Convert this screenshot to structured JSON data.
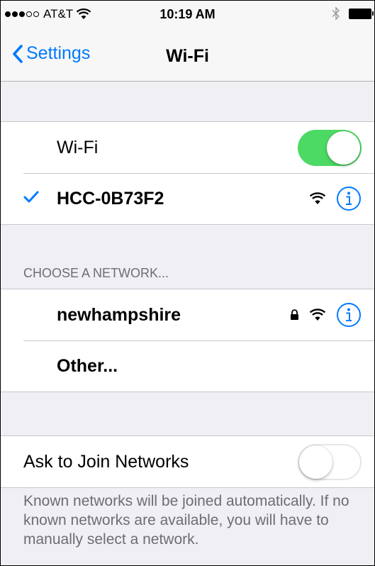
{
  "status_bar": {
    "carrier": "AT&T",
    "time": "10:19 AM",
    "signal_bars_filled": 3,
    "signal_bars_total": 5
  },
  "nav": {
    "back_label": "Settings",
    "title": "Wi-Fi"
  },
  "wifi_toggle": {
    "label": "Wi-Fi",
    "state": "on"
  },
  "connected_network": {
    "name": "HCC-0B73F2",
    "icons": [
      "checkmark-icon",
      "wifi-icon",
      "info-icon"
    ]
  },
  "choose_section": {
    "header": "CHOOSE A NETWORK...",
    "networks": [
      {
        "name": "newhampshire",
        "icons": [
          "lock-icon",
          "wifi-icon",
          "info-icon"
        ]
      },
      {
        "name": "Other..."
      }
    ]
  },
  "ask_to_join": {
    "label": "Ask to Join Networks",
    "state": "off"
  },
  "footer": {
    "text": "Known networks will be joined automatically. If no known networks are available, you will have to manually select a network."
  },
  "colors": {
    "accent": "#007aff",
    "toggle_on": "#4cd964",
    "background": "#efeff4",
    "secondary_text": "#6d6d72"
  }
}
